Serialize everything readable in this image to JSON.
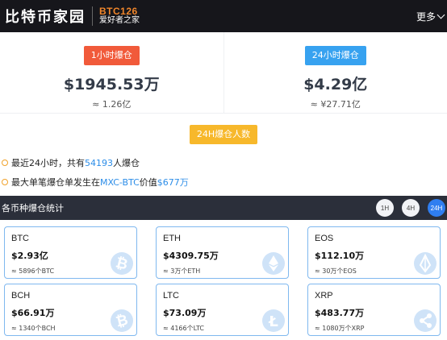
{
  "header": {
    "logo_cn": "比特币家园",
    "logo_en": "BTC126",
    "logo_sub": "爱好者之家",
    "more_label": "更多"
  },
  "stats": [
    {
      "tag": "1小时爆仓",
      "value": "$1945.53万",
      "approx": "≈ 1.26亿",
      "tag_color": "#f15a3a"
    },
    {
      "tag": "24小时爆仓",
      "value": "$4.29亿",
      "approx": "≈ ¥27.71亿",
      "tag_color": "#37a2f0"
    }
  ],
  "count_tag": "24H爆仓人数",
  "info": {
    "line1_prefix": "最近24小时，共有",
    "line1_count": "54193",
    "line1_suffix": "人爆仓",
    "line2_prefix": "最大单笔爆仓单发生在",
    "line2_pair": "MXC-BTC",
    "line2_mid": "价值",
    "line2_value": "$677万"
  },
  "section": {
    "title": "各币种爆仓统计",
    "timeframes": [
      "1H",
      "4H",
      "24H"
    ],
    "active_timeframe": "24H"
  },
  "coins": [
    {
      "symbol": "BTC",
      "value": "$2.93亿",
      "sub": "≈ 5896个BTC",
      "icon": "bitcoin-icon"
    },
    {
      "symbol": "ETH",
      "value": "$4309.75万",
      "sub": "≈ 3万个ETH",
      "icon": "ethereum-icon"
    },
    {
      "symbol": "EOS",
      "value": "$112.10万",
      "sub": "≈ 30万个EOS",
      "icon": "eos-icon"
    },
    {
      "symbol": "BCH",
      "value": "$66.91万",
      "sub": "≈ 1340个BCH",
      "icon": "bitcoin-cash-icon"
    },
    {
      "symbol": "LTC",
      "value": "$73.09万",
      "sub": "≈ 4166个LTC",
      "icon": "litecoin-icon"
    },
    {
      "symbol": "XRP",
      "value": "$483.77万",
      "sub": "≈ 1080万个XRP",
      "icon": "ripple-icon"
    }
  ],
  "colors": {
    "header_bg": "#16161b",
    "accent_orange": "#f0862b",
    "highlight_blue": "#2c8de8",
    "active_timeframe": "#2f7ef0",
    "card_border": "#7fb8ef"
  }
}
